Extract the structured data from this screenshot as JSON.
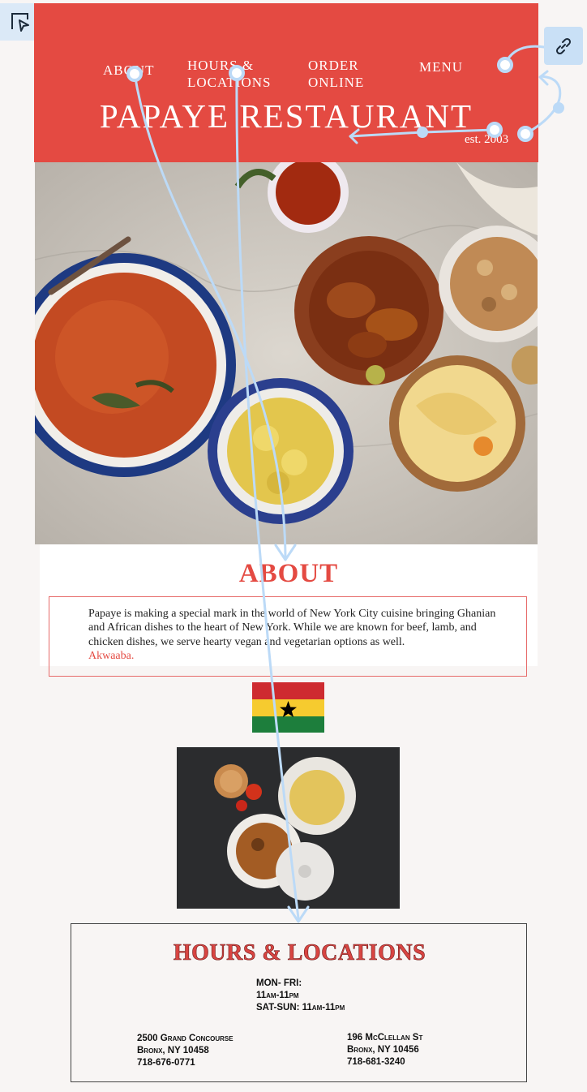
{
  "nav": {
    "items": [
      {
        "line1": "ABOUT",
        "line2": ""
      },
      {
        "line1": "HOURS &",
        "line2": "LOCATIONS"
      },
      {
        "line1": "ORDER",
        "line2": "ONLINE"
      },
      {
        "line1": "MENU",
        "line2": ""
      }
    ]
  },
  "brand": {
    "name": "PAPAYE RESTAURANT",
    "established": "est. 2003"
  },
  "about": {
    "title": "ABOUT",
    "body": "Papaye is making a special mark in the world of New York City cuisine bringing Ghanian  and African dishes to the heart of New York. While we are known for beef, lamb, and chicken dishes, we serve hearty vegan and vegetarian options as well.",
    "highlight": "Akwaaba."
  },
  "hours": {
    "title": "HOURS & LOCATIONS",
    "weekday": "MON- FRI:",
    "weekday_time": "11am-11pm",
    "weekend": "SAT-SUN: 11am-11pm",
    "locations": [
      {
        "street": "2500 Grand Concourse",
        "city": "Bronx, NY 10458",
        "phone": "718-676-0771"
      },
      {
        "street": "196 McClellan St",
        "city": "Bronx, NY 10456",
        "phone": "718-681-3240"
      }
    ]
  },
  "colors": {
    "accent": "#e44a42",
    "overlay": "#bcdaf7",
    "background": "#f8f5f4"
  },
  "icons": {
    "tool": "cursor-select-icon",
    "link": "link-icon"
  }
}
